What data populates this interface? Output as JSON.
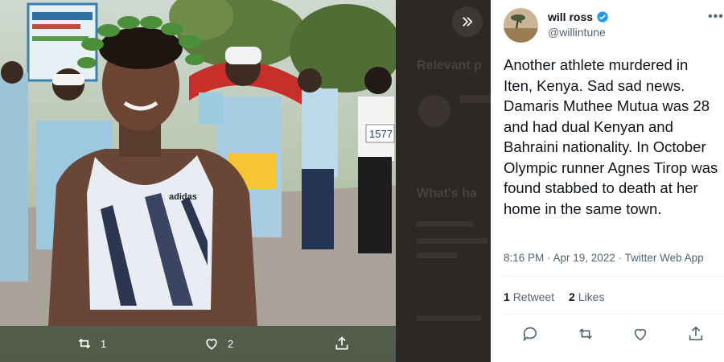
{
  "photo": {
    "bib_text": "1577",
    "sponsor_tag": "adidas",
    "actions": {
      "retweets": "1",
      "likes": "2"
    }
  },
  "collapse": {
    "icon": "double-chevron-right-icon"
  },
  "ghost_sidebar": {
    "heading1": "Relevant p",
    "heading2": "What's ha"
  },
  "tweet": {
    "author_name": "will ross",
    "verified": true,
    "author_handle": "@willintune",
    "text": "Another athlete murdered in Iten, Kenya.  Sad sad news. Damaris Muthee Mutua was 28 and had dual Kenyan and Bahraini nationality. In October Olympic runner Agnes Tirop was found stabbed to death at her home in the same town.",
    "timestamp": "8:16 PM · Apr 19, 2022 · Twitter Web App",
    "retweet_count": "1",
    "retweet_label": "Retweet",
    "like_count": "2",
    "like_label": "Likes"
  },
  "colors": {
    "verified": "#1d9bf0",
    "secondary_text": "#536471",
    "primary_text": "#0f1419"
  }
}
